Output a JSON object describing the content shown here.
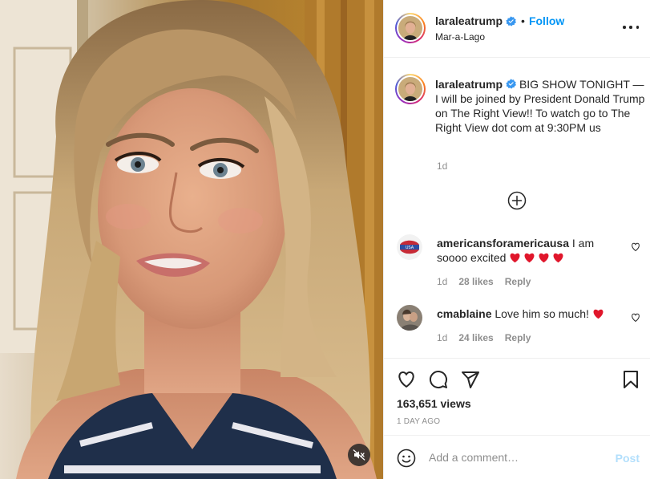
{
  "header": {
    "username": "laraleatrump",
    "follow_label": "Follow",
    "location": "Mar-a-Lago"
  },
  "caption": {
    "username": "laraleatrump",
    "text": "BIG SHOW TONIGHT — I will be joined by President Donald Trump on The Right View!! To watch go to The Right View dot com at 9:30PM us",
    "time": "1d"
  },
  "comments": [
    {
      "username": "americansforamericausa",
      "text": "I am soooo excited",
      "hearts": 4,
      "time": "1d",
      "likes": "28 likes",
      "reply_label": "Reply"
    },
    {
      "username": "cmablaine",
      "text": "Love him so much!",
      "hearts": 1,
      "time": "1d",
      "likes": "24 likes",
      "reply_label": "Reply"
    }
  ],
  "stats": {
    "views": "163,651 views",
    "posted": "1 DAY AGO"
  },
  "comment_box": {
    "placeholder": "Add a comment…",
    "post_label": "Post"
  },
  "icons": {
    "verified": "verified-badge-icon",
    "more": "more-options-icon",
    "load_more": "plus-circle-icon",
    "like": "heart-icon",
    "comment": "comment-icon",
    "share": "share-icon",
    "save": "bookmark-icon",
    "emoji": "emoji-icon",
    "mute": "speaker-muted-icon"
  },
  "colors": {
    "accent": "#0095f6",
    "post_disabled": "#b2dffc",
    "secondary_text": "#8e8e8e",
    "heart_emoji": "#e0162b"
  }
}
